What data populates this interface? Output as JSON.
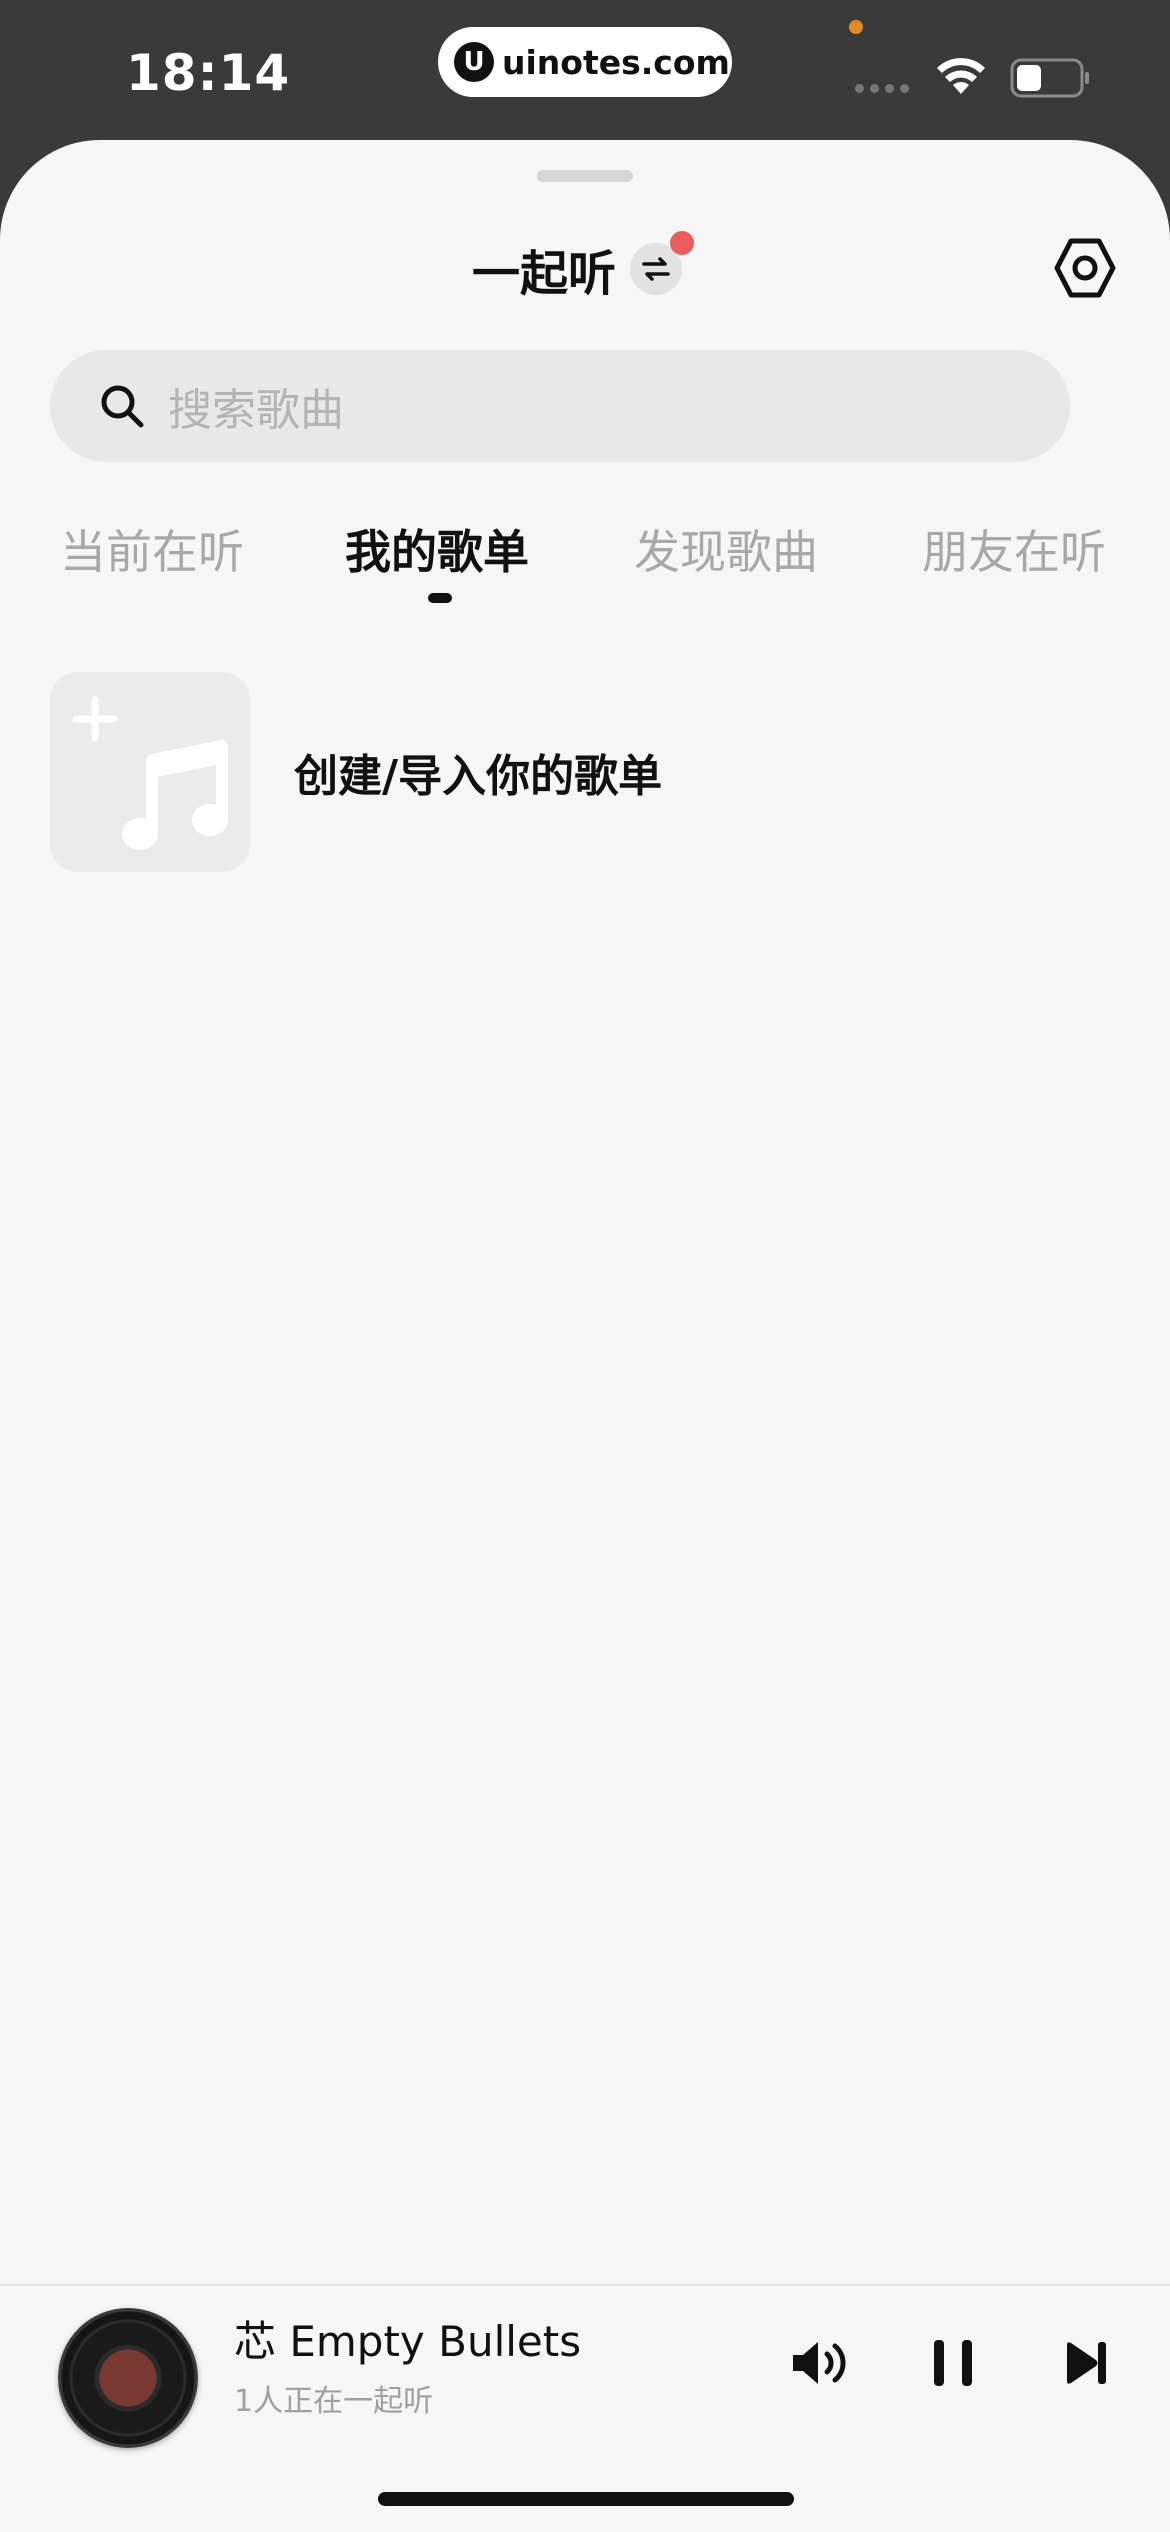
{
  "status_bar": {
    "time": "18:14",
    "url": "uinotes.com",
    "url_logo": "U"
  },
  "header": {
    "title": "一起听"
  },
  "search": {
    "placeholder": "搜索歌曲"
  },
  "tabs": [
    {
      "label": "当前在听",
      "active": false
    },
    {
      "label": "我的歌单",
      "active": true
    },
    {
      "label": "发现歌曲",
      "active": false
    },
    {
      "label": "朋友在听",
      "active": false
    }
  ],
  "playlist": {
    "create_label": "创建/导入你的歌单"
  },
  "player": {
    "song_title": "芯 Empty Bullets",
    "listeners": "1人正在一起听"
  },
  "colors": {
    "accent_red": "#ea5c5c",
    "sheet_bg": "#f6f6f6",
    "status_bg": "#3a3a3a"
  },
  "icons": [
    "switch-icon",
    "settings-icon",
    "search-icon",
    "plus-icon",
    "music-note-icon",
    "volume-icon",
    "pause-icon",
    "next-icon",
    "wifi-icon",
    "battery-icon"
  ]
}
